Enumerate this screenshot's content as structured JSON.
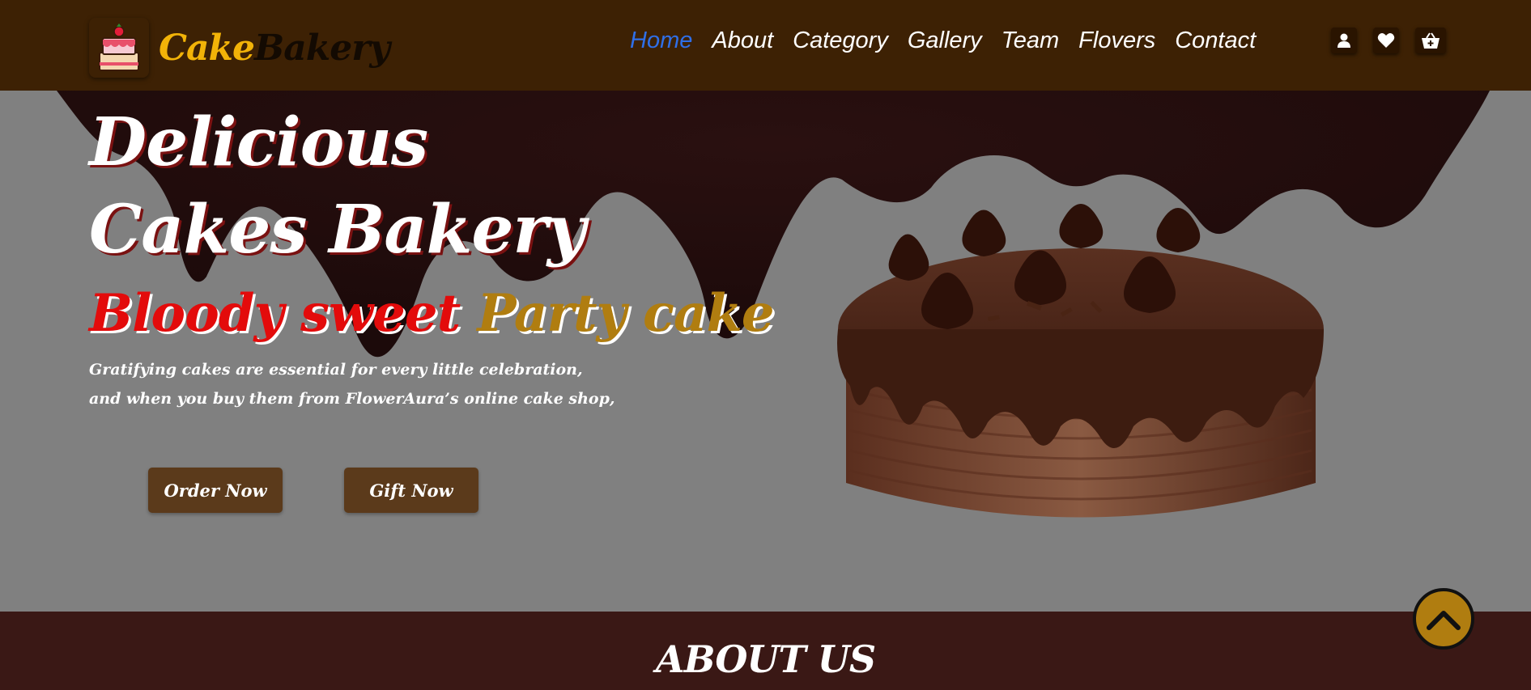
{
  "brand": {
    "part1": "Cake",
    "part2": "Bakery"
  },
  "nav": {
    "items": [
      {
        "label": "Home",
        "active": true
      },
      {
        "label": "About"
      },
      {
        "label": "Category"
      },
      {
        "label": "Gallery"
      },
      {
        "label": "Team"
      },
      {
        "label": "Flovers"
      },
      {
        "label": "Contact"
      }
    ]
  },
  "header_icons": [
    "user-icon",
    "heart-icon",
    "basket-icon"
  ],
  "hero": {
    "title_line1": "Delicious",
    "title_line2": "Cakes Bakery",
    "tag_red": "Bloody sweet",
    "tag_gold": "Party cake",
    "desc_line1": "Gratifying cakes are essential for every little celebration,",
    "desc_line2": "and when you buy them from FlowerAura’s online cake shop,",
    "order_label": "Order Now",
    "gift_label": "Gift Now"
  },
  "about": {
    "title": "ABOUT US"
  },
  "colors": {
    "header_bg": "#3d2104",
    "brand_yellow": "#f2b308",
    "nav_active": "#2f6fe8",
    "hero_bg": "#808080",
    "button_bg": "#5b3a1b",
    "tag_red": "#e30b0b",
    "tag_gold": "#b07d10",
    "about_bg": "#3a1815"
  }
}
